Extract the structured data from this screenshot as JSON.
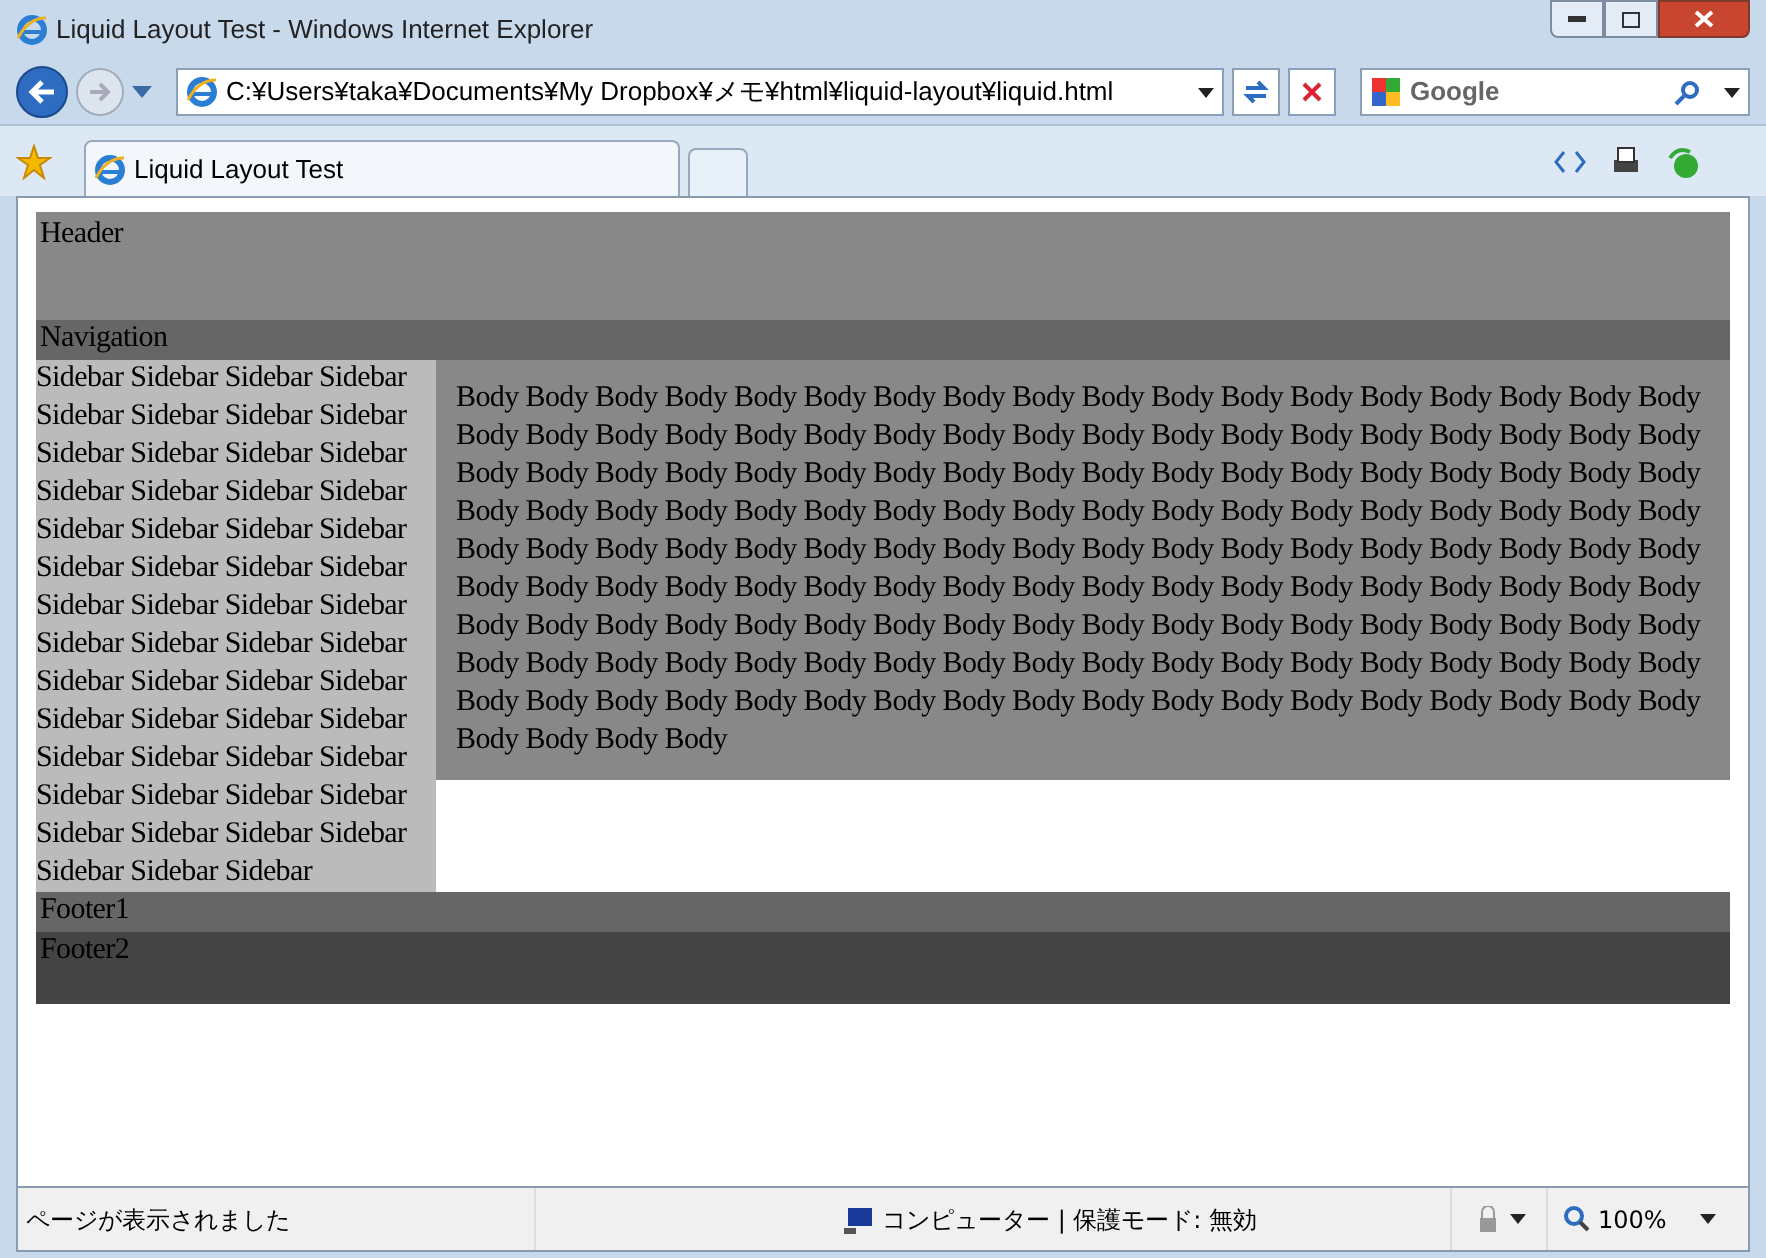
{
  "window": {
    "title": "Liquid Layout Test - Windows Internet Explorer"
  },
  "address_bar": {
    "value": "C:¥Users¥taka¥Documents¥My Dropbox¥メモ¥html¥liquid-layout¥liquid.html"
  },
  "search": {
    "placeholder": "Google"
  },
  "tabs": [
    {
      "label": "Liquid Layout Test",
      "selected": true
    }
  ],
  "page": {
    "header": "Header",
    "navigation": "Navigation",
    "sidebar": "Sidebar Sidebar Sidebar Sidebar Sidebar Sidebar Sidebar Sidebar Sidebar Sidebar Sidebar Sidebar Sidebar Sidebar Sidebar Sidebar Sidebar Sidebar Sidebar Sidebar Sidebar Sidebar Sidebar Sidebar Sidebar Sidebar Sidebar Sidebar Sidebar Sidebar Sidebar Sidebar Sidebar Sidebar Sidebar Sidebar Sidebar Sidebar Sidebar Sidebar Sidebar Sidebar Sidebar Sidebar Sidebar Sidebar Sidebar Sidebar Sidebar Sidebar Sidebar Sidebar Sidebar Sidebar Sidebar",
    "body": "Body Body Body Body Body Body Body Body Body Body Body Body Body Body Body Body Body Body Body Body Body Body Body Body Body Body Body Body Body Body Body Body Body Body Body Body Body Body Body Body Body Body Body Body Body Body Body Body Body Body Body Body Body Body Body Body Body Body Body Body Body Body Body Body Body Body Body Body Body Body Body Body Body Body Body Body Body Body Body Body Body Body Body Body Body Body Body Body Body Body Body Body Body Body Body Body Body Body Body Body Body Body Body Body Body Body Body Body Body Body Body Body Body Body Body Body Body Body Body Body Body Body Body Body Body Body Body Body Body Body Body Body Body Body Body Body Body Body Body Body Body Body Body Body Body Body Body Body Body Body Body Body Body Body Body Body Body Body Body Body Body Body Body Body Body Body",
    "footer1": "Footer1",
    "footer2": "Footer2"
  },
  "status_bar": {
    "message": "ページが表示されました",
    "zone": "コンピューター | 保護モード: 無効",
    "zoom": "100%"
  }
}
